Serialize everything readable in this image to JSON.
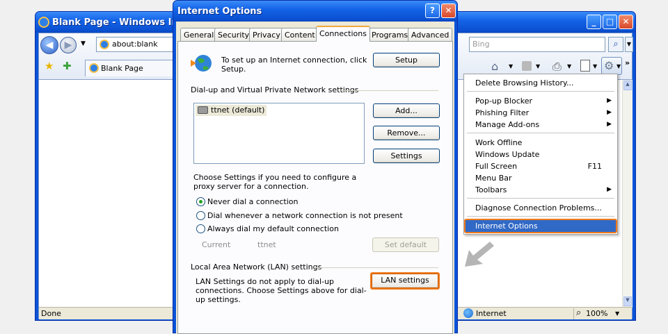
{
  "browser": {
    "title": "Blank Page - Windows Interr",
    "address": "about:blank",
    "search_placeholder": "Bing",
    "tab_label": "Blank Page",
    "status_left": "Done",
    "status_zone": "Internet",
    "zoom": "100%",
    "window_buttons": {
      "minimize": "_",
      "maximize": "□",
      "close": "✕"
    }
  },
  "menu": {
    "items": [
      {
        "label": "Delete Browsing History..."
      },
      {
        "label": "Pop-up Blocker",
        "submenu": true
      },
      {
        "label": "Phishing Filter",
        "submenu": true
      },
      {
        "label": "Manage Add-ons",
        "submenu": true
      },
      {
        "label": "Work Offline"
      },
      {
        "label": "Windows Update"
      },
      {
        "label": "Full Screen",
        "shortcut": "F11"
      },
      {
        "label": "Menu Bar"
      },
      {
        "label": "Toolbars",
        "submenu": true
      },
      {
        "label": "Diagnose Connection Problems..."
      },
      {
        "label": "Internet Options",
        "highlighted": true
      }
    ]
  },
  "dialog": {
    "title": "Internet Options",
    "help_button": "?",
    "close_button": "✕",
    "tabs": [
      "General",
      "Security",
      "Privacy",
      "Content",
      "Connections",
      "Programs",
      "Advanced"
    ],
    "active_tab": "Connections",
    "setup_text": "To set up an Internet connection, click Setup.",
    "setup_button": "Setup",
    "dialup_group": "Dial-up and Virtual Private Network settings",
    "dialup_entries": [
      "ttnet (default)"
    ],
    "add_button": "Add...",
    "remove_button": "Remove...",
    "settings_button": "Settings",
    "proxy_text": "Choose Settings if you need to configure a proxy server for a connection.",
    "radio_options": [
      {
        "label": "Never dial a connection",
        "selected": true
      },
      {
        "label": "Dial whenever a network connection is not present",
        "selected": false
      },
      {
        "label": "Always dial my default connection",
        "selected": false
      }
    ],
    "current_label": "Current",
    "current_value": "ttnet",
    "set_default_button": "Set default",
    "lan_group": "Local Area Network (LAN) settings",
    "lan_text": "LAN Settings do not apply to dial-up connections. Choose Settings above for dial-up settings.",
    "lan_button": "LAN settings"
  },
  "colors": {
    "accent": "#f07a1a",
    "titlebar": "#0a53d8",
    "selection": "#3169c6"
  }
}
